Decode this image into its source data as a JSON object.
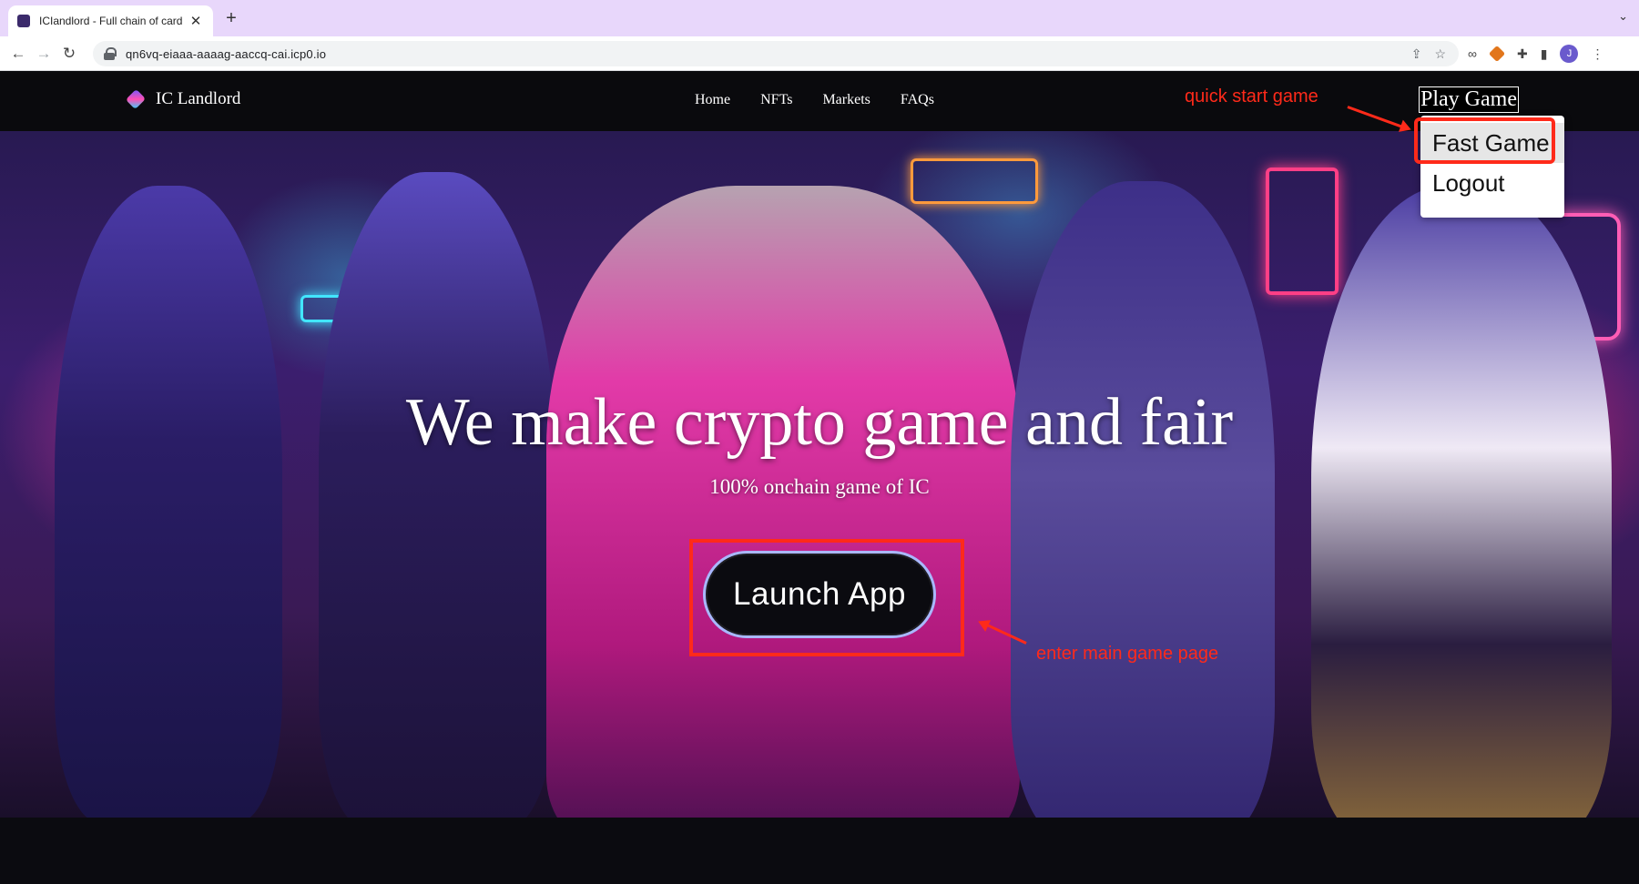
{
  "browser": {
    "tab_title": "ICIandlord - Full chain of card",
    "new_tab": "+",
    "url": "qn6vq-eiaaa-aaaag-aaccq-cai.icp0.io",
    "avatar_initial": "J"
  },
  "site": {
    "logo_text": "IC Landlord",
    "nav": [
      "Home",
      "NFTs",
      "Markets",
      "FAQs"
    ],
    "play_game": "Play Game",
    "dropdown": [
      "Fast Game",
      "Logout"
    ]
  },
  "hero": {
    "title": "We make crypto game and fair",
    "subtitle": "100% onchain game of IC",
    "launch_label": "Launch App"
  },
  "annotations": {
    "quick_start": "quick start game",
    "enter_main": "enter main game page"
  },
  "colors": {
    "annotation": "#ff2a1a",
    "header_bg": "#0a0a0d",
    "tabbar_bg": "#e8d7fb"
  }
}
